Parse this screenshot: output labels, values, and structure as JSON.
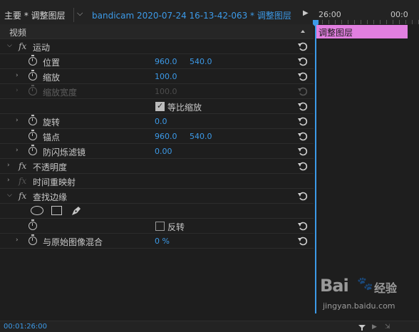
{
  "header": {
    "panel_title": "主要 * 调整图层",
    "clip_path": "bandicam  2020-07-24  16-13-42-063 * 调整图层",
    "timecode_start": "26:00",
    "timecode_end": "00:0"
  },
  "panel": {
    "section_video": "视频",
    "motion": {
      "label": "运动",
      "position": {
        "label": "位置",
        "x": "960.0",
        "y": "540.0"
      },
      "scale": {
        "label": "缩放",
        "value": "100.0"
      },
      "scale_width": {
        "label": "缩放宽度",
        "value": "100.0"
      },
      "uniform_scale": {
        "label": "等比缩放",
        "checked": true
      },
      "rotation": {
        "label": "旋转",
        "value": "0.0"
      },
      "anchor": {
        "label": "锚点",
        "x": "960.0",
        "y": "540.0"
      },
      "flicker": {
        "label": "防闪烁滤镜",
        "value": "0.00"
      }
    },
    "opacity": {
      "label": "不透明度"
    },
    "time_remap": {
      "label": "时间重映射"
    },
    "find_edges": {
      "label": "查找边缘",
      "invert": {
        "label": "反转",
        "checked": false
      },
      "blend": {
        "label": "与原始图像混合",
        "value": "0 %"
      }
    }
  },
  "timeline": {
    "clip_label": "调整图层",
    "clip_color": "#e27fe0",
    "playhead_color": "#3c9ae8"
  },
  "footer": {
    "timecode": "00:01:26:00"
  },
  "watermark": {
    "brand": "Bai",
    "text": "经验",
    "url": "jingyan.baidu.com"
  }
}
